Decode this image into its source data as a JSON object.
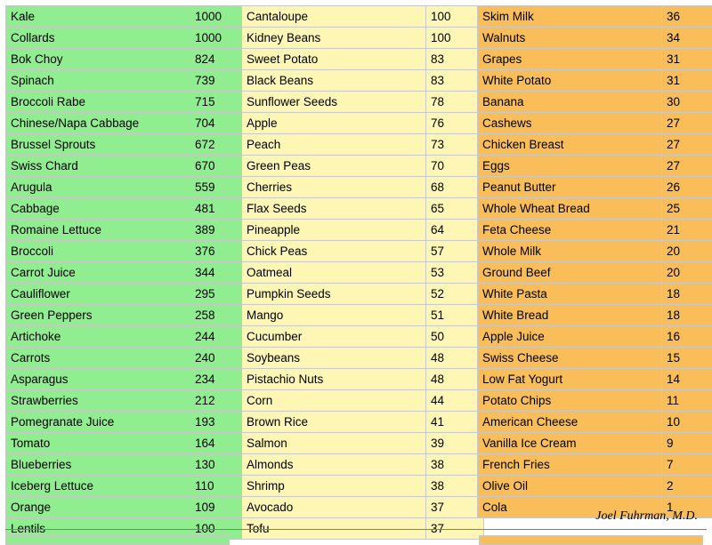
{
  "byline": "Joel Fuhrman, M.D.",
  "colors": {
    "green": "#90ee90",
    "yellow": "#fdf6b4",
    "orange": "#f9bd59",
    "border": "#c8c8c8"
  },
  "columns": [
    {
      "color_key": "green",
      "rows": [
        {
          "name": "Kale",
          "value": "1000"
        },
        {
          "name": "Collards",
          "value": "1000"
        },
        {
          "name": "Bok Choy",
          "value": "824"
        },
        {
          "name": "Spinach",
          "value": "739"
        },
        {
          "name": "Broccoli Rabe",
          "value": "715"
        },
        {
          "name": "Chinese/Napa Cabbage",
          "value": "704"
        },
        {
          "name": "Brussel Sprouts",
          "value": "672"
        },
        {
          "name": "Swiss Chard",
          "value": "670"
        },
        {
          "name": "Arugula",
          "value": "559"
        },
        {
          "name": "Cabbage",
          "value": "481"
        },
        {
          "name": "Romaine Lettuce",
          "value": "389"
        },
        {
          "name": "Broccoli",
          "value": "376"
        },
        {
          "name": "Carrot Juice",
          "value": "344"
        },
        {
          "name": "Cauliflower",
          "value": "295"
        },
        {
          "name": "Green Peppers",
          "value": "258"
        },
        {
          "name": "Artichoke",
          "value": "244"
        },
        {
          "name": "Carrots",
          "value": "240"
        },
        {
          "name": "Asparagus",
          "value": "234"
        },
        {
          "name": "Strawberries",
          "value": "212"
        },
        {
          "name": "Pomegranate Juice",
          "value": "193"
        },
        {
          "name": "Tomato",
          "value": "164"
        },
        {
          "name": "Blueberries",
          "value": "130"
        },
        {
          "name": "Iceberg Lettuce",
          "value": "110"
        },
        {
          "name": "Orange",
          "value": "109"
        },
        {
          "name": "Lentils",
          "value": "100"
        }
      ]
    },
    {
      "color_key": "yellow",
      "rows": [
        {
          "name": "Cantaloupe",
          "value": "100"
        },
        {
          "name": "Kidney Beans",
          "value": "100"
        },
        {
          "name": "Sweet Potato",
          "value": "83"
        },
        {
          "name": "Black Beans",
          "value": "83"
        },
        {
          "name": "Sunflower Seeds",
          "value": "78"
        },
        {
          "name": "Apple",
          "value": "76"
        },
        {
          "name": "Peach",
          "value": "73"
        },
        {
          "name": "Green Peas",
          "value": "70"
        },
        {
          "name": "Cherries",
          "value": "68"
        },
        {
          "name": "Flax Seeds",
          "value": "65"
        },
        {
          "name": "Pineapple",
          "value": "64"
        },
        {
          "name": "Chick Peas",
          "value": "57"
        },
        {
          "name": "Oatmeal",
          "value": "53"
        },
        {
          "name": "Pumpkin Seeds",
          "value": "52"
        },
        {
          "name": "Mango",
          "value": "51"
        },
        {
          "name": "Cucumber",
          "value": "50"
        },
        {
          "name": "Soybeans",
          "value": "48"
        },
        {
          "name": "Pistachio Nuts",
          "value": "48"
        },
        {
          "name": "Corn",
          "value": "44"
        },
        {
          "name": "Brown Rice",
          "value": "41"
        },
        {
          "name": "Salmon",
          "value": "39"
        },
        {
          "name": "Almonds",
          "value": "38"
        },
        {
          "name": "Shrimp",
          "value": "38"
        },
        {
          "name": "Avocado",
          "value": "37"
        },
        {
          "name": "Tofu",
          "value": "37"
        }
      ]
    },
    {
      "color_key": "orange",
      "rows": [
        {
          "name": "Skim Milk",
          "value": "36"
        },
        {
          "name": "Walnuts",
          "value": "34"
        },
        {
          "name": "Grapes",
          "value": "31"
        },
        {
          "name": "White Potato",
          "value": "31"
        },
        {
          "name": "Banana",
          "value": "30"
        },
        {
          "name": "Cashews",
          "value": "27"
        },
        {
          "name": "Chicken Breast",
          "value": "27"
        },
        {
          "name": "Eggs",
          "value": "27"
        },
        {
          "name": "Peanut Butter",
          "value": "26"
        },
        {
          "name": "Whole Wheat Bread",
          "value": "25"
        },
        {
          "name": "Feta Cheese",
          "value": "21"
        },
        {
          "name": "Whole Milk",
          "value": "20"
        },
        {
          "name": "Ground Beef",
          "value": "20"
        },
        {
          "name": "White Pasta",
          "value": "18"
        },
        {
          "name": "White Bread",
          "value": "18"
        },
        {
          "name": "Apple Juice",
          "value": "16"
        },
        {
          "name": "Swiss Cheese",
          "value": "15"
        },
        {
          "name": "Low Fat Yogurt",
          "value": "14"
        },
        {
          "name": "Potato Chips",
          "value": "11"
        },
        {
          "name": "American Cheese",
          "value": "10"
        },
        {
          "name": "Vanilla Ice Cream",
          "value": "9"
        },
        {
          "name": "French Fries",
          "value": "7"
        },
        {
          "name": "Olive Oil",
          "value": "2"
        },
        {
          "name": "Cola",
          "value": "1"
        }
      ]
    }
  ]
}
